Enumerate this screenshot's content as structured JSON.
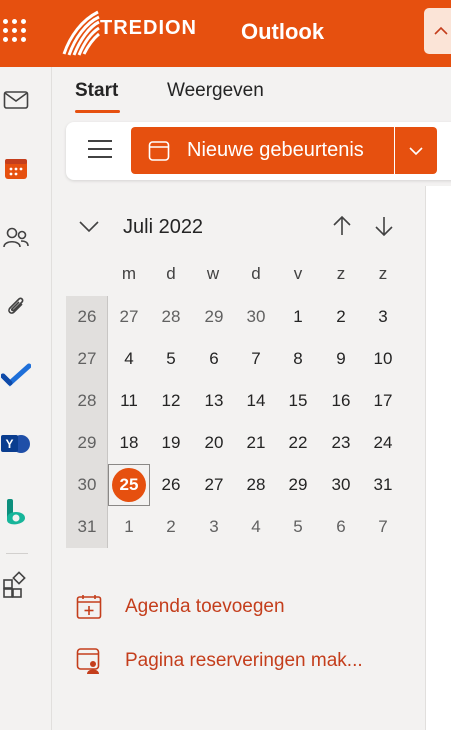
{
  "header": {
    "brand": "TREDION",
    "app_title": "Outlook",
    "colors": {
      "accent": "#e6500f",
      "accent_light": "#fbe4d7"
    }
  },
  "rail": {
    "items": [
      {
        "icon": "mail-icon"
      },
      {
        "icon": "calendar-icon"
      },
      {
        "icon": "people-icon"
      },
      {
        "icon": "paperclip-icon"
      },
      {
        "icon": "todo-icon"
      },
      {
        "icon": "yammer-icon"
      },
      {
        "icon": "bookings-icon"
      },
      {
        "icon": "more-apps-icon"
      }
    ]
  },
  "tabs": [
    {
      "label": "Start",
      "active": true
    },
    {
      "label": "Weergeven",
      "active": false
    }
  ],
  "toolbar": {
    "new_event_label": "Nieuwe gebeurtenis"
  },
  "calendar": {
    "month_label": "Juli 2022",
    "weekdays": [
      "m",
      "d",
      "w",
      "d",
      "v",
      "z",
      "z"
    ],
    "weeks": [
      {
        "num": "26",
        "days": [
          "27",
          "28",
          "29",
          "30",
          "1",
          "2",
          "3"
        ]
      },
      {
        "num": "27",
        "days": [
          "4",
          "5",
          "6",
          "7",
          "8",
          "9",
          "10"
        ]
      },
      {
        "num": "28",
        "days": [
          "11",
          "12",
          "13",
          "14",
          "15",
          "16",
          "17"
        ]
      },
      {
        "num": "29",
        "days": [
          "18",
          "19",
          "20",
          "21",
          "22",
          "23",
          "24"
        ]
      },
      {
        "num": "30",
        "days": [
          "25",
          "26",
          "27",
          "28",
          "29",
          "30",
          "31"
        ]
      },
      {
        "num": "31",
        "days": [
          "1",
          "2",
          "3",
          "4",
          "5",
          "6",
          "7"
        ]
      }
    ],
    "today": "25"
  },
  "links": {
    "add_calendar": "Agenda toevoegen",
    "booking_page": "Pagina reserveringen mak..."
  }
}
